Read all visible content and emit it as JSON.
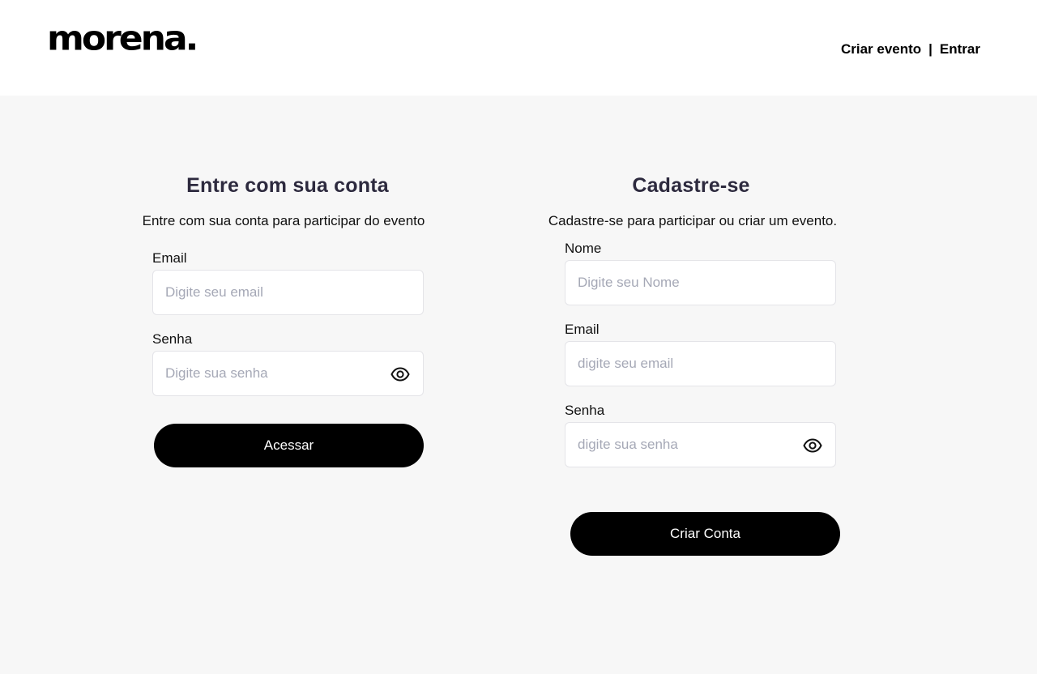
{
  "header": {
    "logo": "morena.",
    "nav_create_event": "Criar evento",
    "nav_separator": "|",
    "nav_login": "Entrar"
  },
  "login": {
    "title": "Entre com sua conta",
    "subtitle": "Entre com sua conta para participar do evento",
    "email_label": "Email",
    "email_placeholder": "Digite seu email",
    "password_label": "Senha",
    "password_placeholder": "Digite sua senha",
    "submit_label": "Acessar"
  },
  "signup": {
    "title": "Cadastre-se",
    "subtitle": "Cadastre-se para participar ou criar um evento.",
    "name_label": "Nome",
    "name_placeholder": "Digite seu Nome",
    "email_label": "Email",
    "email_placeholder": "digite seu email",
    "password_label": "Senha",
    "password_placeholder": "digite sua senha",
    "submit_label": "Criar Conta"
  },
  "icons": {
    "password_toggle": "eye-icon"
  },
  "colors": {
    "header_bg": "#ffffff",
    "page_bg": "#f7f7f7",
    "title": "#2d2a3e",
    "button_bg": "#000000",
    "placeholder": "#a5a8b6"
  }
}
